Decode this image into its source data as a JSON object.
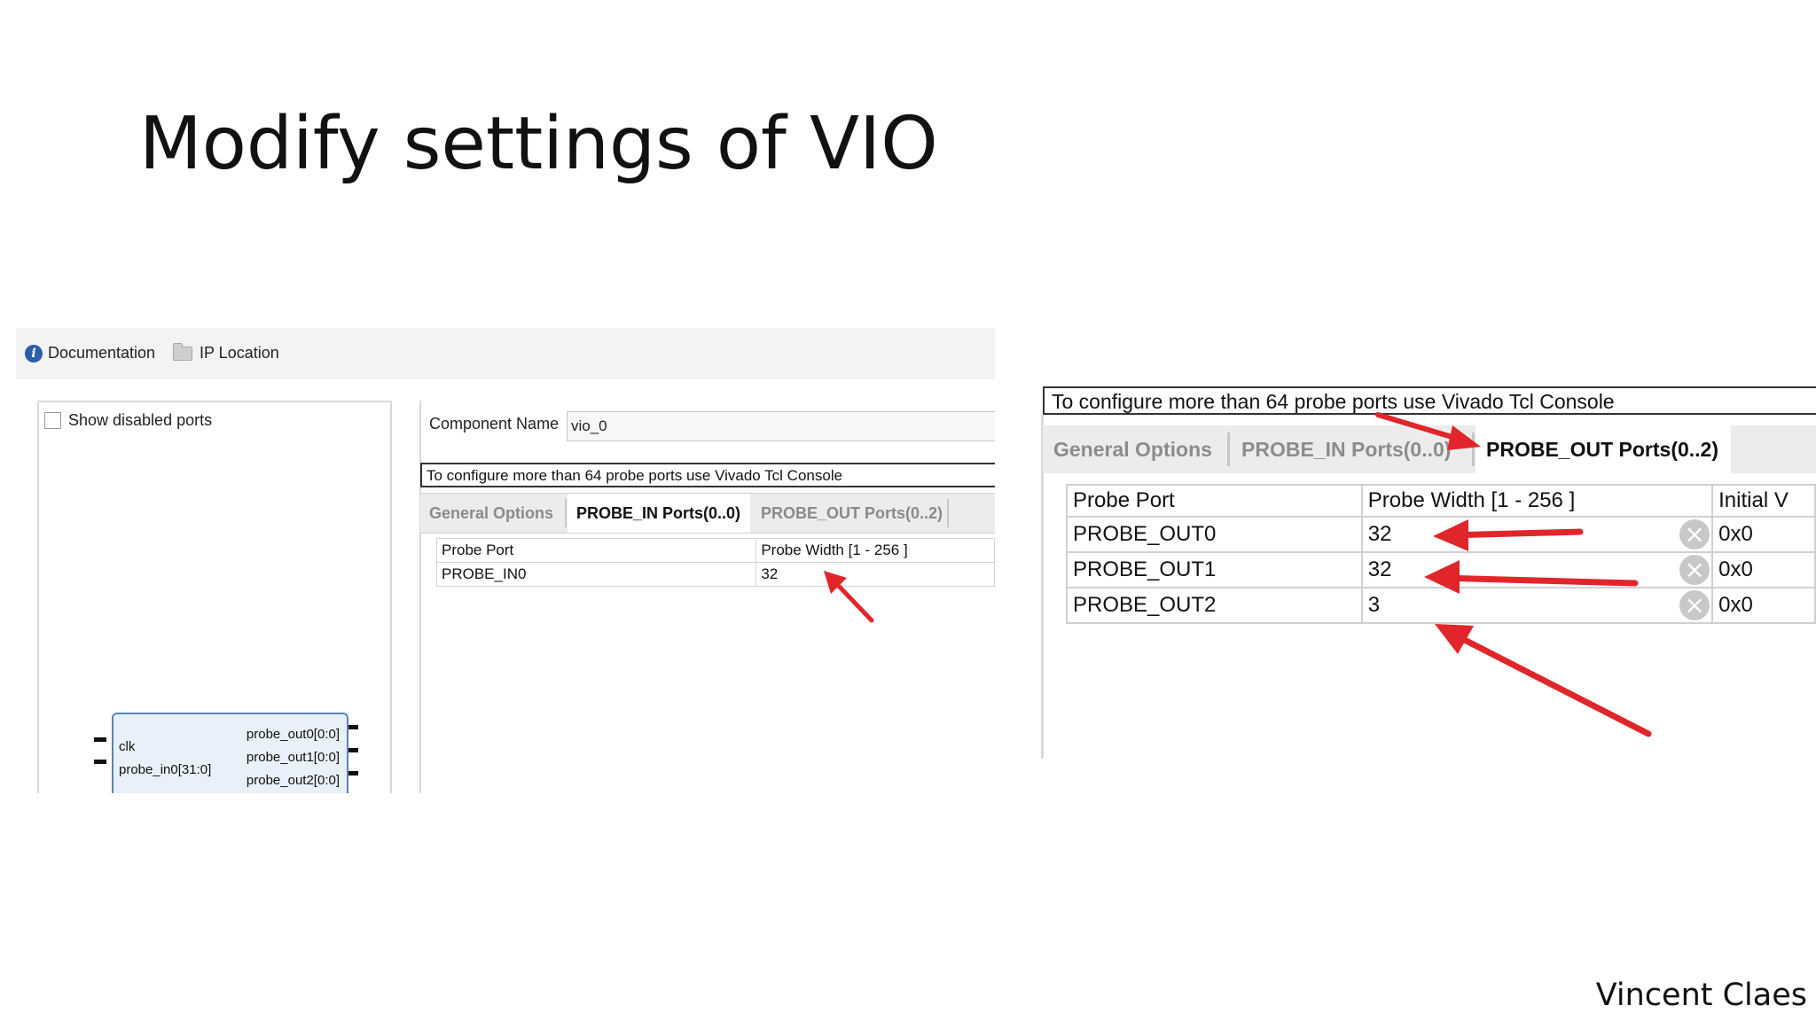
{
  "slide": {
    "title": "Modify settings of VIO",
    "author": "Vincent Claes"
  },
  "left_panel": {
    "toolbar": {
      "documentation_label": "Documentation",
      "ip_location_label": "IP Location"
    },
    "show_disabled_ports_label": "Show disabled ports",
    "block": {
      "inputs": [
        "clk",
        "probe_in0[31:0]"
      ],
      "outputs": [
        "probe_out0[0:0]",
        "probe_out1[0:0]",
        "probe_out2[0:0]"
      ]
    },
    "component_name_label": "Component Name",
    "component_name_value": "vio_0",
    "tcl_note": "To configure more than 64 probe ports use Vivado Tcl Console",
    "tabs": [
      {
        "label": "General Options",
        "active": false
      },
      {
        "label": "PROBE_IN Ports(0..0)",
        "active": true
      },
      {
        "label": "PROBE_OUT Ports(0..2)",
        "active": false
      }
    ],
    "table": {
      "headers": [
        "Probe Port",
        "Probe Width [1 - 256 ]"
      ],
      "rows": [
        [
          "PROBE_IN0",
          "32"
        ]
      ]
    }
  },
  "right_panel": {
    "tcl_note": "To configure more than 64 probe ports use Vivado Tcl Console",
    "tabs": [
      {
        "label": "General Options",
        "active": false
      },
      {
        "label": "PROBE_IN Ports(0..0)",
        "active": false
      },
      {
        "label": "PROBE_OUT Ports(0..2)",
        "active": true
      }
    ],
    "table": {
      "headers": [
        "Probe Port",
        "Probe Width [1 - 256 ]",
        "Initial V"
      ],
      "rows": [
        [
          "PROBE_OUT0",
          "32",
          "0x0"
        ],
        [
          "PROBE_OUT1",
          "32",
          "0x0"
        ],
        [
          "PROBE_OUT2",
          "3",
          "0x0"
        ]
      ]
    }
  },
  "colors": {
    "arrow": "#e0262b",
    "block_fill": "#e8f1fa",
    "block_border": "#5a83b6",
    "info_icon": "#2a5ea8"
  }
}
